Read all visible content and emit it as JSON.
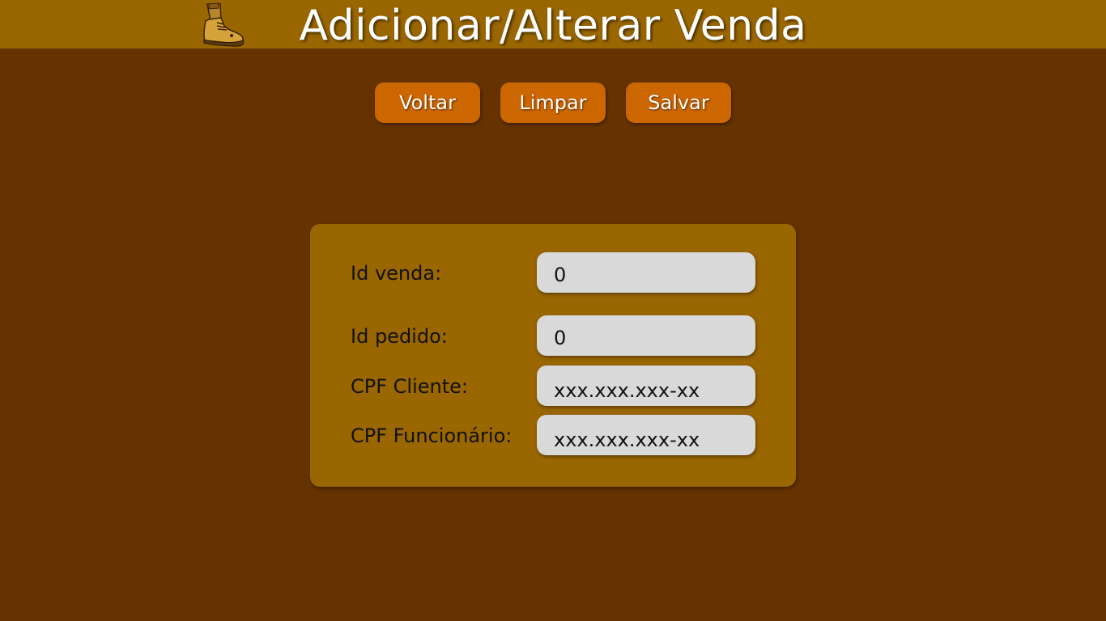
{
  "header": {
    "title": "Adicionar/Alterar Venda",
    "logo_icon": "boot-icon"
  },
  "toolbar": {
    "voltar_label": "Voltar",
    "limpar_label": "Limpar",
    "salvar_label": "Salvar"
  },
  "form": {
    "id_venda": {
      "label": "Id venda:",
      "value": "0"
    },
    "id_pedido": {
      "label": "Id pedido:",
      "value": "0"
    },
    "cpf_cliente": {
      "label": "CPF Cliente:",
      "placeholder": "xxx.xxx.xxx-xx"
    },
    "cpf_funcionario": {
      "label": "CPF Funcionário:",
      "placeholder": "xxx.xxx.xxx-xx"
    }
  },
  "colors": {
    "background": "#663300",
    "header": "#996600",
    "panel": "#996600",
    "button": "#cc6600",
    "input": "#d9d9d9"
  }
}
